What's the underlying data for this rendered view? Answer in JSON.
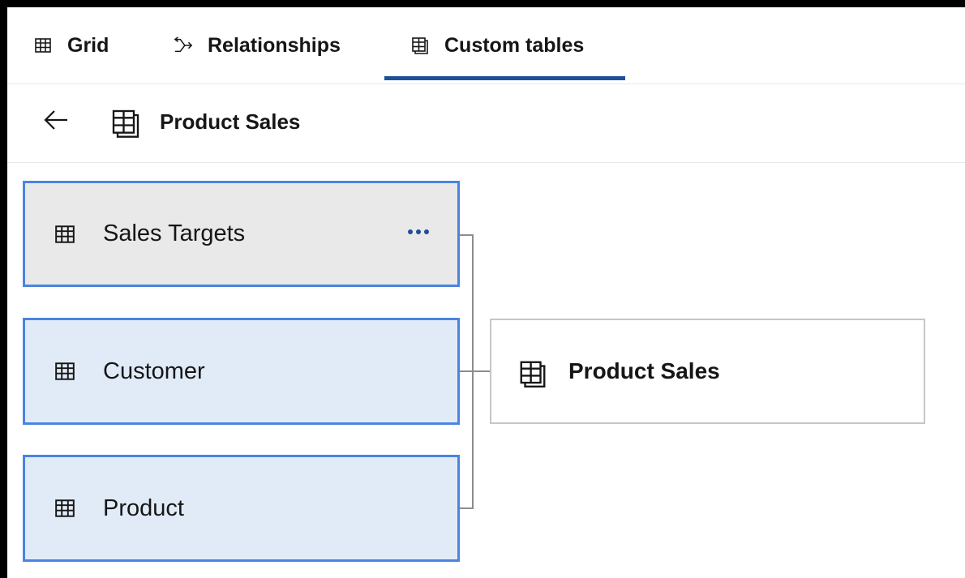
{
  "tabs": [
    {
      "label": "Grid",
      "icon": "grid-icon"
    },
    {
      "label": "Relationships",
      "icon": "relationships-icon"
    },
    {
      "label": "Custom tables",
      "icon": "custom-table-icon",
      "active": true
    }
  ],
  "colors": {
    "accent": "#1f4f9a",
    "node_border": "#4b84df",
    "node_selected_bg": "#e1ebf8",
    "node_hover_bg": "#e9e9e9"
  },
  "header": {
    "back_icon": "arrow-left-icon",
    "icon": "custom-table-icon",
    "title": "Product Sales"
  },
  "diagram": {
    "sources": [
      {
        "label": "Sales Targets",
        "icon": "table-icon",
        "has_overflow_menu": true
      },
      {
        "label": "Customer",
        "icon": "table-icon"
      },
      {
        "label": "Product",
        "icon": "table-icon"
      }
    ],
    "overflow_icon": "overflow-menu-icon",
    "target": {
      "label": "Product Sales",
      "icon": "custom-table-icon"
    }
  }
}
